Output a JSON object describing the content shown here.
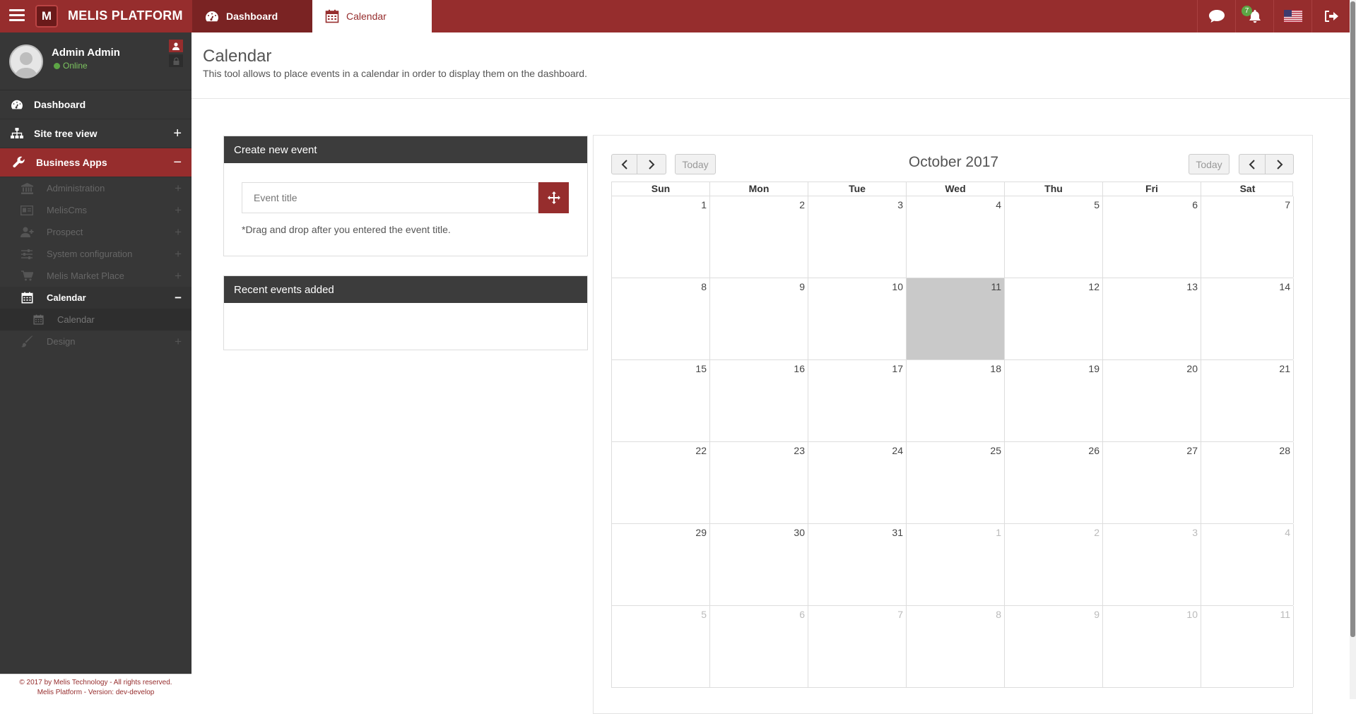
{
  "header": {
    "brand": "MELIS PLATFORM",
    "logo_letter": "M",
    "tabs": [
      {
        "label": "Dashboard",
        "icon": "dashboard-icon"
      },
      {
        "label": "Calendar",
        "icon": "calendar-icon"
      }
    ],
    "notification_count": "7",
    "icons": [
      "chat-icon",
      "bell-icon",
      "us-flag-icon",
      "logout-icon"
    ],
    "colors": {
      "brand": "#962d2d",
      "sidebar": "#373737",
      "online": "#5da545"
    }
  },
  "sidebar": {
    "user": {
      "name": "Admin Admin",
      "status": "Online"
    },
    "items": [
      {
        "label": "Dashboard",
        "icon": "dashboard-icon",
        "toggle": ""
      },
      {
        "label": "Site tree view",
        "icon": "sitemap-icon",
        "toggle": "+"
      },
      {
        "label": "Business Apps",
        "icon": "wrench-icon",
        "toggle": "−"
      }
    ],
    "sub_items": [
      {
        "label": "Administration",
        "icon": "bank-icon",
        "toggle": "+"
      },
      {
        "label": "MelisCms",
        "icon": "id-card-icon",
        "toggle": "+"
      },
      {
        "label": "Prospect",
        "icon": "user-plus-icon",
        "toggle": "+"
      },
      {
        "label": "System configuration",
        "icon": "sliders-icon",
        "toggle": "+"
      },
      {
        "label": "Melis Market Place",
        "icon": "cart-icon",
        "toggle": "+"
      },
      {
        "label": "Calendar",
        "icon": "calendar-icon",
        "toggle": "−"
      },
      {
        "label": "Calendar",
        "icon": "calendar-icon",
        "toggle": ""
      },
      {
        "label": "Design",
        "icon": "brush-icon",
        "toggle": "+"
      }
    ],
    "footer": {
      "line1": "© 2017 by Melis Technology - All rights reserved.",
      "line2": "Melis Platform - Version: dev-develop"
    }
  },
  "main": {
    "title": "Calendar",
    "description": "This tool allows to place events in a calendar in order to display them on the dashboard.",
    "create_panel": {
      "title": "Create new event",
      "placeholder": "Event title",
      "hint": "*Drag and drop after you entered the event title."
    },
    "recent_panel": {
      "title": "Recent events added"
    }
  },
  "calendar": {
    "title": "October 2017",
    "today_label": "Today",
    "weekdays": [
      "Sun",
      "Mon",
      "Tue",
      "Wed",
      "Thu",
      "Fri",
      "Sat"
    ],
    "weeks": [
      [
        {
          "d": "1"
        },
        {
          "d": "2"
        },
        {
          "d": "3"
        },
        {
          "d": "4"
        },
        {
          "d": "5"
        },
        {
          "d": "6"
        },
        {
          "d": "7"
        }
      ],
      [
        {
          "d": "8"
        },
        {
          "d": "9"
        },
        {
          "d": "10"
        },
        {
          "d": "11",
          "today": true
        },
        {
          "d": "12"
        },
        {
          "d": "13"
        },
        {
          "d": "14"
        }
      ],
      [
        {
          "d": "15"
        },
        {
          "d": "16"
        },
        {
          "d": "17"
        },
        {
          "d": "18"
        },
        {
          "d": "19"
        },
        {
          "d": "20"
        },
        {
          "d": "21"
        }
      ],
      [
        {
          "d": "22"
        },
        {
          "d": "23"
        },
        {
          "d": "24"
        },
        {
          "d": "25"
        },
        {
          "d": "26"
        },
        {
          "d": "27"
        },
        {
          "d": "28"
        }
      ],
      [
        {
          "d": "29"
        },
        {
          "d": "30"
        },
        {
          "d": "31"
        },
        {
          "d": "1",
          "other": true
        },
        {
          "d": "2",
          "other": true
        },
        {
          "d": "3",
          "other": true
        },
        {
          "d": "4",
          "other": true
        }
      ],
      [
        {
          "d": "5",
          "other": true
        },
        {
          "d": "6",
          "other": true
        },
        {
          "d": "7",
          "other": true
        },
        {
          "d": "8",
          "other": true
        },
        {
          "d": "9",
          "other": true
        },
        {
          "d": "10",
          "other": true
        },
        {
          "d": "11",
          "other": true
        }
      ]
    ]
  }
}
